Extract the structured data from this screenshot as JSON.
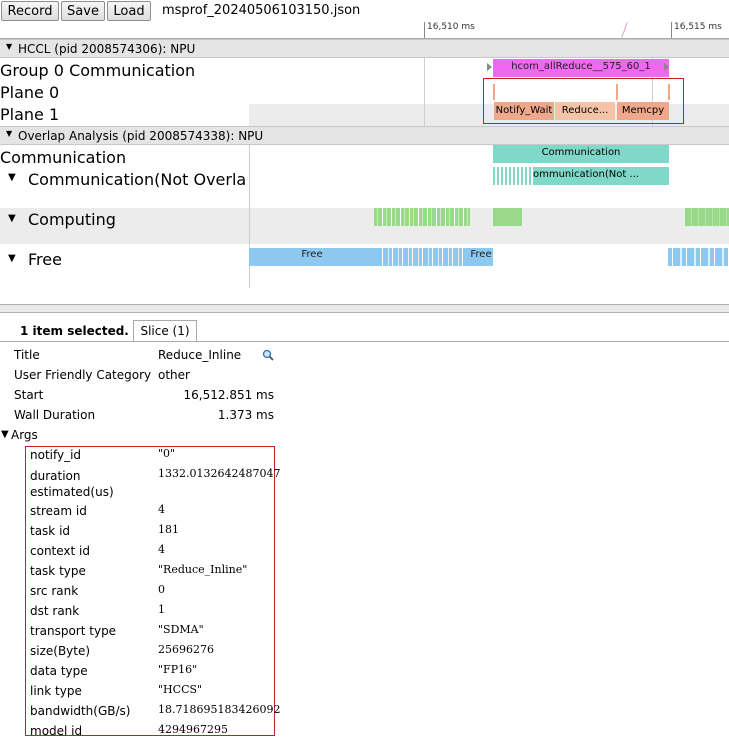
{
  "toolbar": {
    "record_label": "Record",
    "save_label": "Save",
    "load_label": "Load",
    "file_name": "msprof_20240506103150.json"
  },
  "ruler": {
    "tick1": "16,510 ms",
    "tick2": "16,515 ms"
  },
  "processes": {
    "hccl_header": "HCCL (pid 2008574306): NPU",
    "overlap_header": "Overlap Analysis (pid 2008574338): NPU"
  },
  "tracks": {
    "group0": "Group 0 Communication",
    "plane0": "Plane 0",
    "plane1": "Plane 1",
    "communication": "Communication",
    "comm_not_overlap": "Communication(Not Overlap",
    "computing": "Computing",
    "free": "Free"
  },
  "slices": {
    "hcom": "hcom_allReduce__575_60_1",
    "notify_wait": "Notify_Wait",
    "reduce": "Reduce...",
    "memcpy": "Memcpy",
    "communication": "Communication",
    "comm_not": "Communication(Not ...",
    "free1": "Free",
    "free2": "Free"
  },
  "colors": {
    "hcom": "#f068f0",
    "plane": "#f0a88c",
    "communication": "#80d8c8",
    "computing": "#9ad88a",
    "free": "#8cc8f0",
    "highlight_border": "#c81e1e"
  },
  "panel": {
    "selected_text": "1 item selected.",
    "tab_label": "Slice (1)",
    "title_key": "Title",
    "title_val": "Reduce_Inline",
    "category_key": "User Friendly Category",
    "category_val": "other",
    "start_key": "Start",
    "start_val": "16,512.851 ms",
    "wall_key": "Wall Duration",
    "wall_val": "1.373 ms",
    "args_label": "Args"
  },
  "args": [
    {
      "key": "notify_id",
      "value": "\"0\""
    },
    {
      "key": "duration estimated(us)",
      "value": "1332.0132642487047"
    },
    {
      "key": "stream id",
      "value": "4"
    },
    {
      "key": "task id",
      "value": "181"
    },
    {
      "key": "context id",
      "value": "4"
    },
    {
      "key": "task type",
      "value": "\"Reduce_Inline\""
    },
    {
      "key": "src rank",
      "value": "0"
    },
    {
      "key": "dst rank",
      "value": "1"
    },
    {
      "key": "transport type",
      "value": "\"SDMA\""
    },
    {
      "key": "size(Byte)",
      "value": "25696276"
    },
    {
      "key": "data type",
      "value": "\"FP16\""
    },
    {
      "key": "link type",
      "value": "\"HCCS\""
    },
    {
      "key": "bandwidth(GB/s)",
      "value": "18.718695183426092"
    },
    {
      "key": "model id",
      "value": "4294967295"
    }
  ]
}
